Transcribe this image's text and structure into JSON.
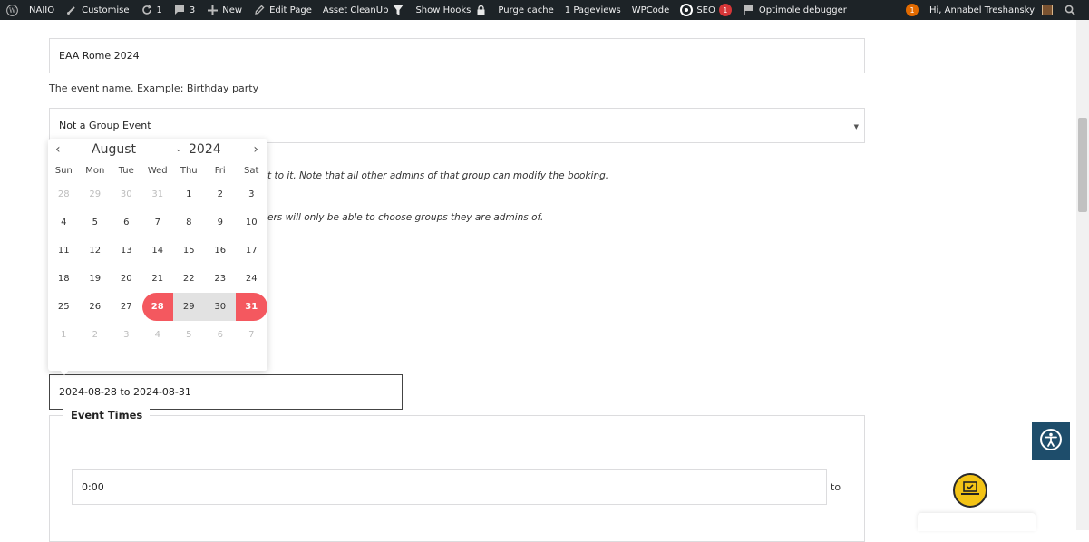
{
  "adminbar": {
    "site_name": "NAIIO",
    "customise": "Customise",
    "updates_count": "1",
    "comments_count": "3",
    "new": "New",
    "edit_page": "Edit Page",
    "asset_cleanup": "Asset CleanUp",
    "show_hooks": "Show Hooks",
    "purge_cache": "Purge cache",
    "pageviews": "1 Pageviews",
    "wpcode": "WPCode",
    "seo": "SEO",
    "seo_badge": "1",
    "optimole": "Optimole debugger",
    "notif_badge": "1",
    "greeting": "Hi, Annabel Treshansky"
  },
  "form": {
    "event_name_value": "EAA Rome 2024",
    "event_name_help": "The event name. Example: Birthday party",
    "group_select_value": "Not a Group Event",
    "group_help_1_tail": "t to it. Note that all other admins of that group can modify the booking.",
    "group_help_2_tail": "ers will only be able to choose groups they are admins of.",
    "date_range_value": "2024-08-28 to 2024-08-31",
    "event_times_legend": "Event Times",
    "start_time_value": "0:00",
    "to_label": "to"
  },
  "calendar": {
    "month": "August",
    "year": "2024",
    "weekdays": [
      "Sun",
      "Mon",
      "Tue",
      "Wed",
      "Thu",
      "Fri",
      "Sat"
    ],
    "days": [
      {
        "d": "28",
        "t": "other"
      },
      {
        "d": "29",
        "t": "other"
      },
      {
        "d": "30",
        "t": "other"
      },
      {
        "d": "31",
        "t": "other"
      },
      {
        "d": "1",
        "t": ""
      },
      {
        "d": "2",
        "t": ""
      },
      {
        "d": "3",
        "t": ""
      },
      {
        "d": "4",
        "t": ""
      },
      {
        "d": "5",
        "t": ""
      },
      {
        "d": "6",
        "t": ""
      },
      {
        "d": "7",
        "t": ""
      },
      {
        "d": "8",
        "t": ""
      },
      {
        "d": "9",
        "t": ""
      },
      {
        "d": "10",
        "t": ""
      },
      {
        "d": "11",
        "t": ""
      },
      {
        "d": "12",
        "t": ""
      },
      {
        "d": "13",
        "t": ""
      },
      {
        "d": "14",
        "t": ""
      },
      {
        "d": "15",
        "t": ""
      },
      {
        "d": "16",
        "t": ""
      },
      {
        "d": "17",
        "t": ""
      },
      {
        "d": "18",
        "t": ""
      },
      {
        "d": "19",
        "t": ""
      },
      {
        "d": "20",
        "t": ""
      },
      {
        "d": "21",
        "t": ""
      },
      {
        "d": "22",
        "t": ""
      },
      {
        "d": "23",
        "t": ""
      },
      {
        "d": "24",
        "t": ""
      },
      {
        "d": "25",
        "t": ""
      },
      {
        "d": "26",
        "t": ""
      },
      {
        "d": "27",
        "t": ""
      },
      {
        "d": "28",
        "t": "start"
      },
      {
        "d": "29",
        "t": "inrange"
      },
      {
        "d": "30",
        "t": "inrange"
      },
      {
        "d": "31",
        "t": "end"
      },
      {
        "d": "1",
        "t": "other"
      },
      {
        "d": "2",
        "t": "other"
      },
      {
        "d": "3",
        "t": "other"
      },
      {
        "d": "4",
        "t": "other"
      },
      {
        "d": "5",
        "t": "other"
      },
      {
        "d": "6",
        "t": "other"
      },
      {
        "d": "7",
        "t": "other"
      }
    ]
  },
  "colors": {
    "adminbar_bg": "#1d2327",
    "range_accent": "#f4585f",
    "range_fill": "#e2e2e2",
    "a11y_bg": "#1e4d6b",
    "help_bg": "#f3c316"
  },
  "icons": [
    "wordpress-icon",
    "brush-icon",
    "refresh-icon",
    "comment-icon",
    "plus-icon",
    "pencil-icon",
    "funnel-icon",
    "lock-icon",
    "wpcode-icon",
    "flag-icon",
    "search-icon",
    "accessibility-icon",
    "laptop-check-icon"
  ]
}
